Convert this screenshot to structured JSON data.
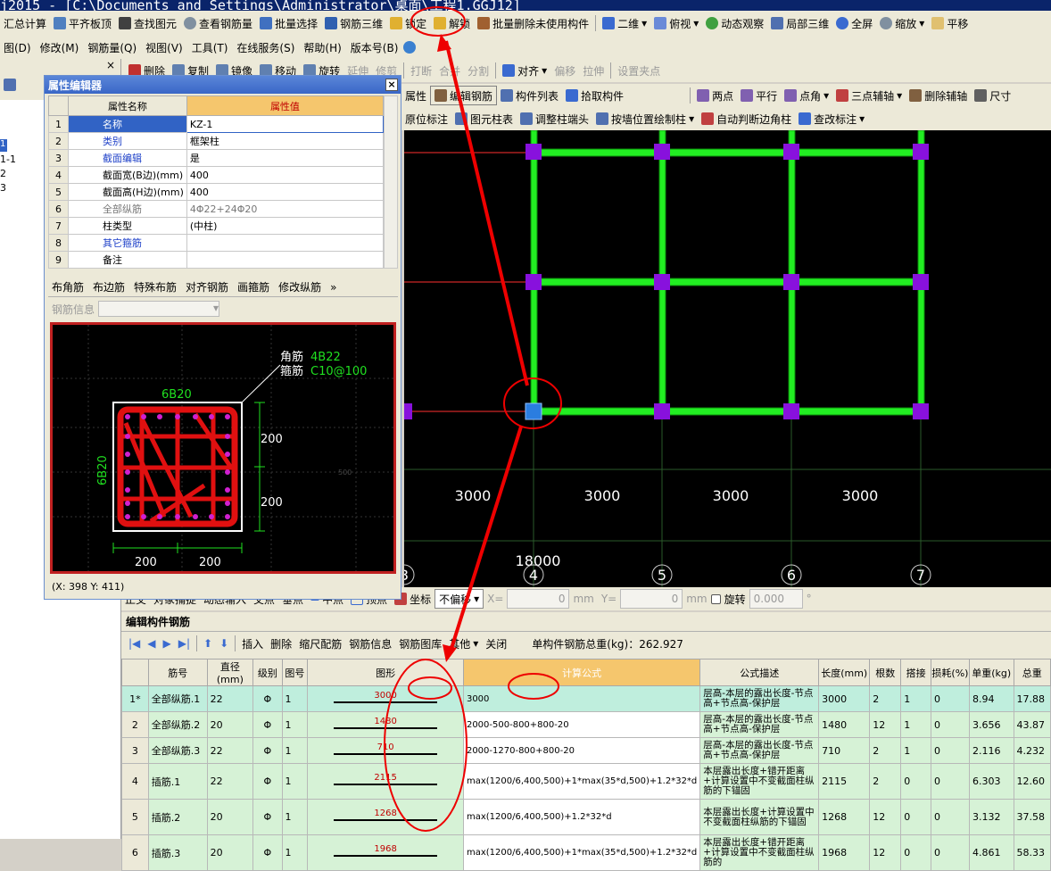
{
  "window": {
    "title": "j2015 - [C:\\Documents and Settings\\Administrator\\桌面\\工程1.GGJ12]"
  },
  "toolbar1": [
    "汇总计算",
    "平齐板顶",
    "查找图元",
    "查看钢筋量",
    "批量选择",
    "钢筋三维",
    "锁定",
    "解锁",
    "批量删除未使用构件",
    "二维",
    "俯视",
    "动态观察",
    "局部三维",
    "全屏",
    "缩放",
    "平移"
  ],
  "menubar": [
    "图(D)",
    "修改(M)",
    "钢筋量(Q)",
    "视图(V)",
    "工具(T)",
    "在线服务(S)",
    "帮助(H)",
    "版本号(B)"
  ],
  "toolbar2": [
    "删除",
    "复制",
    "镜像",
    "移动",
    "旋转",
    "延伸",
    "修剪",
    "打断",
    "合并",
    "分割",
    "对齐",
    "偏移",
    "拉伸",
    "设置夹点"
  ],
  "toolbar3": [
    "属性",
    "编辑钢筋",
    "构件列表",
    "拾取构件",
    "两点",
    "平行",
    "点角",
    "三点辅轴",
    "删除辅轴",
    "尺寸"
  ],
  "toolbar4": [
    "原位标注",
    "图元柱表",
    "调整柱端头",
    "按墙位置绘制柱",
    "自动判断边角柱",
    "查改标注"
  ],
  "left_tree": [
    "1",
    "1-1",
    "2",
    "3"
  ],
  "property_editor": {
    "title": "属性编辑器",
    "col_name": "属性名称",
    "col_value": "属性值",
    "rows": [
      {
        "no": "1",
        "name": "名称",
        "value": "KZ-1"
      },
      {
        "no": "2",
        "name": "类别",
        "value": "框架柱"
      },
      {
        "no": "3",
        "name": "截面编辑",
        "value": "是"
      },
      {
        "no": "4",
        "name": "截面宽(B边)(mm)",
        "value": "400"
      },
      {
        "no": "5",
        "name": "截面高(H边)(mm)",
        "value": "400"
      },
      {
        "no": "6",
        "name": "全部纵筋",
        "value": "4Φ22+24Φ20"
      },
      {
        "no": "7",
        "name": "柱类型",
        "value": "(中柱)"
      },
      {
        "no": "8",
        "name": "其它箍筋",
        "value": ""
      },
      {
        "no": "9",
        "name": "备注",
        "value": ""
      }
    ],
    "tabs": [
      "布角筋",
      "布边筋",
      "特殊布筋",
      "对齐钢筋",
      "画箍筋",
      "修改纵筋"
    ],
    "rebar_info_label": "钢筋信息",
    "section": {
      "corner_label": "角筋",
      "corner_value": "4B22",
      "stirrup_label": "箍筋",
      "stirrup_value": "C10@100",
      "top": "6B20",
      "side": "6B20",
      "d1": "200",
      "d2": "200",
      "w1": "200",
      "w2": "200",
      "tick": "500"
    },
    "coords": "(X: 398 Y: 411)"
  },
  "canvas": {
    "spans": [
      "3000",
      "3000",
      "3000",
      "3000"
    ],
    "total": "18000",
    "axes": [
      "3",
      "4",
      "5",
      "6",
      "7"
    ]
  },
  "snapbar": {
    "items": [
      "正交",
      "对象捕捉",
      "动态输入",
      "交点",
      "垂点",
      "中点",
      "顶点",
      "坐标"
    ],
    "mode": "不偏移",
    "x_label": "X=",
    "x_value": "0",
    "y_label": "Y=",
    "y_value": "0",
    "unit": "mm",
    "rotate_label": "旋转",
    "rotate_value": "0.000",
    "deg": "°"
  },
  "edit_panel": {
    "title": "编辑构件钢筋",
    "toolbar": [
      "插入",
      "删除",
      "缩尺配筋",
      "钢筋信息",
      "钢筋图库",
      "其他",
      "关闭"
    ],
    "total_label": "单构件钢筋总重(kg)：262.927",
    "headers": [
      "",
      "筋号",
      "直径(mm)",
      "级别",
      "图号",
      "图形",
      "计算公式",
      "公式描述",
      "长度(mm)",
      "根数",
      "搭接",
      "损耗(%)",
      "单重(kg)",
      "总重"
    ],
    "rows": [
      {
        "no": "1*",
        "name": "全部纵筋.1",
        "dia": "22",
        "grade": "Φ",
        "fig": "1",
        "shape": "3000",
        "formula": "3000",
        "desc": "层高-本层的露出长度-节点高+节点高-保护层",
        "len": "3000",
        "count": "2",
        "lap": "1",
        "loss": "0",
        "unit": "8.94",
        "total": "17.88"
      },
      {
        "no": "2",
        "name": "全部纵筋.2",
        "dia": "20",
        "grade": "Φ",
        "fig": "1",
        "shape": "1480",
        "formula": "2000-500-800+800-20",
        "desc": "层高-本层的露出长度-节点高+节点高-保护层",
        "len": "1480",
        "count": "12",
        "lap": "1",
        "loss": "0",
        "unit": "3.656",
        "total": "43.87"
      },
      {
        "no": "3",
        "name": "全部纵筋.3",
        "dia": "22",
        "grade": "Φ",
        "fig": "1",
        "shape": "710",
        "formula": "2000-1270-800+800-20",
        "desc": "层高-本层的露出长度-节点高+节点高-保护层",
        "len": "710",
        "count": "2",
        "lap": "1",
        "loss": "0",
        "unit": "2.116",
        "total": "4.232"
      },
      {
        "no": "4",
        "name": "插筋.1",
        "dia": "22",
        "grade": "Φ",
        "fig": "1",
        "shape": "2115",
        "formula": "max(1200/6,400,500)+1*max(35*d,500)+1.2*32*d",
        "desc": "本层露出长度+错开距离+计算设置中不变截面柱纵筋的下锚固",
        "len": "2115",
        "count": "2",
        "lap": "0",
        "loss": "0",
        "unit": "6.303",
        "total": "12.60"
      },
      {
        "no": "5",
        "name": "插筋.2",
        "dia": "20",
        "grade": "Φ",
        "fig": "1",
        "shape": "1268",
        "formula": "max(1200/6,400,500)+1.2*32*d",
        "desc": "本层露出长度+计算设置中不变截面柱纵筋的下锚固",
        "len": "1268",
        "count": "12",
        "lap": "0",
        "loss": "0",
        "unit": "3.132",
        "total": "37.58"
      },
      {
        "no": "6",
        "name": "插筋.3",
        "dia": "20",
        "grade": "Φ",
        "fig": "1",
        "shape": "1968",
        "formula": "max(1200/6,400,500)+1*max(35*d,500)+1.2*32*d",
        "desc": "本层露出长度+错开距离+计算设置中不变截面柱纵筋的",
        "len": "1968",
        "count": "12",
        "lap": "0",
        "loss": "0",
        "unit": "4.861",
        "total": "58.33"
      }
    ]
  },
  "colors": {
    "beam": "#22ee22",
    "column": "#8811dd",
    "selected": "#2b7de0",
    "annot": "#ff0000"
  }
}
